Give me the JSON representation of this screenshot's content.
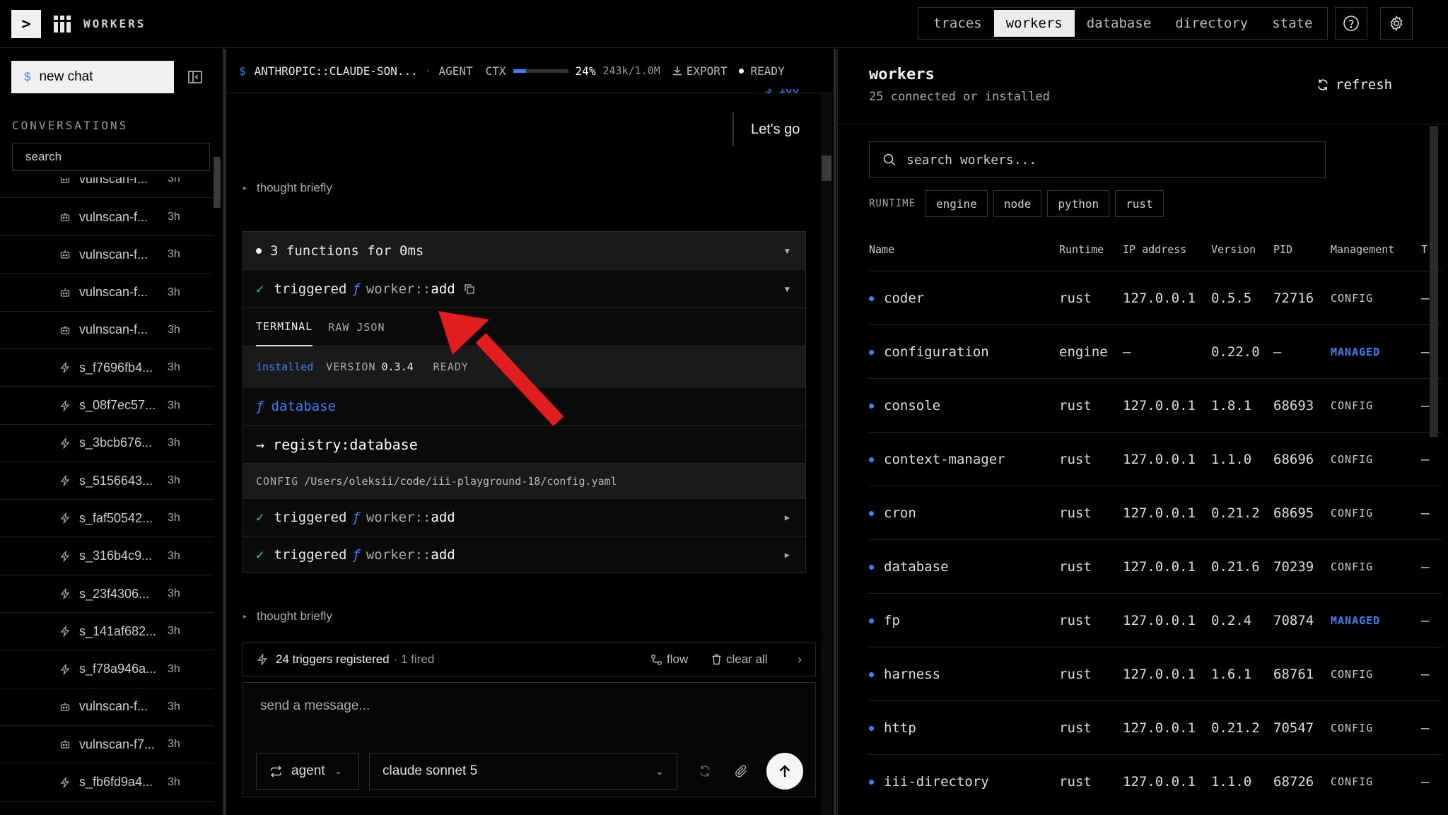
{
  "topbar": {
    "prompt_glyph": ">",
    "app_title": "WORKERS",
    "tabs": [
      {
        "label": "traces",
        "active": false
      },
      {
        "label": "workers",
        "active": true
      },
      {
        "label": "database",
        "active": false
      },
      {
        "label": "directory",
        "active": false
      },
      {
        "label": "state",
        "active": false
      }
    ],
    "help_icon": "question-circle-icon",
    "settings_icon": "gear-icon"
  },
  "sidebar": {
    "new_chat_label": "new chat",
    "conversations_header": "CONVERSATIONS",
    "search_placeholder": "search",
    "items": [
      {
        "name": "vulnscan-f...",
        "time": "3h",
        "icon": "bot"
      },
      {
        "name": "vulnscan-f...",
        "time": "3h",
        "icon": "bot"
      },
      {
        "name": "vulnscan-f...",
        "time": "3h",
        "icon": "bot"
      },
      {
        "name": "vulnscan-f...",
        "time": "3h",
        "icon": "bot"
      },
      {
        "name": "s_f7696fb4...",
        "time": "3h",
        "icon": "bolt"
      },
      {
        "name": "s_08f7ec57...",
        "time": "3h",
        "icon": "bolt"
      },
      {
        "name": "s_3bcb676...",
        "time": "3h",
        "icon": "bolt"
      },
      {
        "name": "s_5156643...",
        "time": "3h",
        "icon": "bolt"
      },
      {
        "name": "s_faf50542...",
        "time": "3h",
        "icon": "bolt"
      },
      {
        "name": "s_316b4c9...",
        "time": "3h",
        "icon": "bolt"
      },
      {
        "name": "s_23f4306...",
        "time": "3h",
        "icon": "bolt"
      },
      {
        "name": "s_141af682...",
        "time": "3h",
        "icon": "bolt"
      },
      {
        "name": "s_f78a946a...",
        "time": "3h",
        "icon": "bolt"
      },
      {
        "name": "vulnscan-f...",
        "time": "3h",
        "icon": "bot"
      },
      {
        "name": "vulnscan-f7...",
        "time": "3h",
        "icon": "bot"
      },
      {
        "name": "s_fb6fd9a4...",
        "time": "3h",
        "icon": "bolt"
      }
    ],
    "partial_top_item": {
      "name": "vulnscan-f...",
      "time": "3h"
    }
  },
  "chat": {
    "header": {
      "model": "ANTHROPIC::CLAUDE-SON...",
      "mode": "AGENT",
      "ctx_label": "CTX",
      "ctx_fraction": 0.24,
      "ctx_percent": "24%",
      "ctx_tokens": "243k/1.0M",
      "export_label": "EXPORT",
      "status": "READY"
    },
    "partial_text": "$ 100",
    "user_message": "Let's go",
    "thought_1": "thought briefly",
    "thought_2": "thought briefly",
    "function_block": {
      "title": "3 functions for 0ms",
      "calls": [
        {
          "status": "triggered",
          "fn_prefix": "worker::",
          "fn_name": "add",
          "expanded": true
        },
        {
          "status": "triggered",
          "fn_prefix": "worker::",
          "fn_name": "add",
          "expanded": false
        },
        {
          "status": "triggered",
          "fn_prefix": "worker::",
          "fn_name": "add",
          "expanded": false
        }
      ],
      "tabs": [
        "TERMINAL",
        "RAW JSON"
      ],
      "meta": {
        "state": "installed",
        "version_label": "VERSION",
        "version": "0.3.4",
        "ready": "READY"
      },
      "fn_line": "database",
      "arrow_line": "registry:database",
      "config_label": "CONFIG",
      "config_path": "/Users/oleksii/code/iii-playground-18/config.yaml"
    },
    "triggers": {
      "summary": "24 triggers registered",
      "fired": "· 1 fired",
      "flow_label": "flow",
      "clear_label": "clear all"
    },
    "composer": {
      "placeholder": "send a message...",
      "mode": "agent",
      "model": "claude sonnet 5"
    }
  },
  "workers": {
    "title": "workers",
    "subtitle": "25 connected or installed",
    "refresh_label": "refresh",
    "search_placeholder": "search workers...",
    "runtime_label": "RUNTIME",
    "runtimes": [
      "engine",
      "node",
      "python",
      "rust"
    ],
    "columns": [
      "Name",
      "Runtime",
      "IP address",
      "Version",
      "PID",
      "Management",
      "T"
    ],
    "rows": [
      {
        "name": "coder",
        "runtime": "rust",
        "ip": "127.0.0.1",
        "version": "0.5.5",
        "pid": "72716",
        "management": "CONFIG",
        "t": "—"
      },
      {
        "name": "configuration",
        "runtime": "engine",
        "ip": "—",
        "version": "0.22.0",
        "pid": "—",
        "management": "MANAGED",
        "t": "—"
      },
      {
        "name": "console",
        "runtime": "rust",
        "ip": "127.0.0.1",
        "version": "1.8.1",
        "pid": "68693",
        "management": "CONFIG",
        "t": "—"
      },
      {
        "name": "context-manager",
        "runtime": "rust",
        "ip": "127.0.0.1",
        "version": "1.1.0",
        "pid": "68696",
        "management": "CONFIG",
        "t": "—"
      },
      {
        "name": "cron",
        "runtime": "rust",
        "ip": "127.0.0.1",
        "version": "0.21.2",
        "pid": "68695",
        "management": "CONFIG",
        "t": "—"
      },
      {
        "name": "database",
        "runtime": "rust",
        "ip": "127.0.0.1",
        "version": "0.21.6",
        "pid": "70239",
        "management": "CONFIG",
        "t": "—"
      },
      {
        "name": "fp",
        "runtime": "rust",
        "ip": "127.0.0.1",
        "version": "0.2.4",
        "pid": "70874",
        "management": "MANAGED",
        "t": "—"
      },
      {
        "name": "harness",
        "runtime": "rust",
        "ip": "127.0.0.1",
        "version": "1.6.1",
        "pid": "68761",
        "management": "CONFIG",
        "t": "—"
      },
      {
        "name": "http",
        "runtime": "rust",
        "ip": "127.0.0.1",
        "version": "0.21.2",
        "pid": "70547",
        "management": "CONFIG",
        "t": "—"
      },
      {
        "name": "iii-directory",
        "runtime": "rust",
        "ip": "127.0.0.1",
        "version": "1.1.0",
        "pid": "68726",
        "management": "CONFIG",
        "t": "—"
      }
    ]
  },
  "colors": {
    "accent": "#3b82f6",
    "success": "#34d399",
    "annotation_arrow": "#e11d1d"
  }
}
